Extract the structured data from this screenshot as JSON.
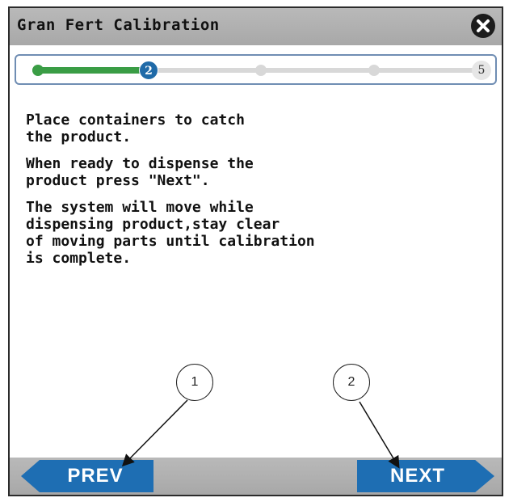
{
  "dialog": {
    "title": "Gran Fert Calibration"
  },
  "progress": {
    "current_step": "2",
    "total_steps": "5"
  },
  "instructions": [
    "Place containers to catch\nthe product.",
    "When ready to dispense the\nproduct press \"Next\".",
    "The system will move while\ndispensing product,stay clear\nof moving parts until calibration\nis complete."
  ],
  "buttons": {
    "prev_label": "PREV",
    "next_label": "NEXT"
  },
  "callouts": [
    "1",
    "2"
  ],
  "colors": {
    "accent_blue": "#1e6eb3",
    "progress_green": "#3a9d45",
    "bar_gray": "#a8a8a8"
  }
}
